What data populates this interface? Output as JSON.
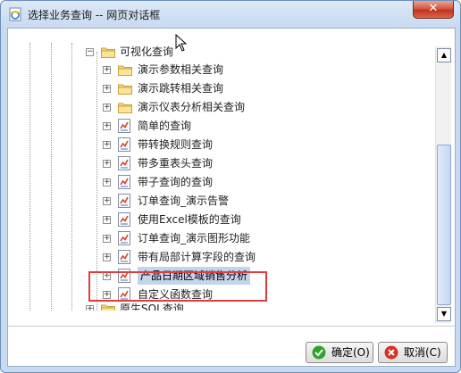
{
  "window": {
    "title": "选择业务查询 -- 网页对话框",
    "close_glyph": "✕"
  },
  "tree": {
    "group": "可视化查询",
    "items": [
      {
        "label": "演示参数相关查询",
        "type": "folder"
      },
      {
        "label": "演示跳转相关查询",
        "type": "folder"
      },
      {
        "label": "演示仪表分析相关查询",
        "type": "folder"
      },
      {
        "label": "简单的查询",
        "type": "report"
      },
      {
        "label": "带转换规则查询",
        "type": "report"
      },
      {
        "label": "带多重表头查询",
        "type": "report"
      },
      {
        "label": "带子查询的查询",
        "type": "report"
      },
      {
        "label": "订单查询_演示告警",
        "type": "report"
      },
      {
        "label": "使用Excel模板的查询",
        "type": "report"
      },
      {
        "label": "订单查询_演示图形功能",
        "type": "report"
      },
      {
        "label": "带有局部计算字段的查询",
        "type": "report"
      },
      {
        "label": "产品日期区域销售分析",
        "type": "report",
        "selected": true
      },
      {
        "label": "自定义函数查询",
        "type": "report"
      }
    ],
    "next_group": "原生SQL查询"
  },
  "buttons": {
    "ok": "确定(O)",
    "cancel": "取消(C)"
  },
  "colors": {
    "selection": "#c4d4ec",
    "highlight_border": "#e23b3b",
    "ok_icon": "#2fa12f",
    "cancel_icon": "#d93025"
  }
}
